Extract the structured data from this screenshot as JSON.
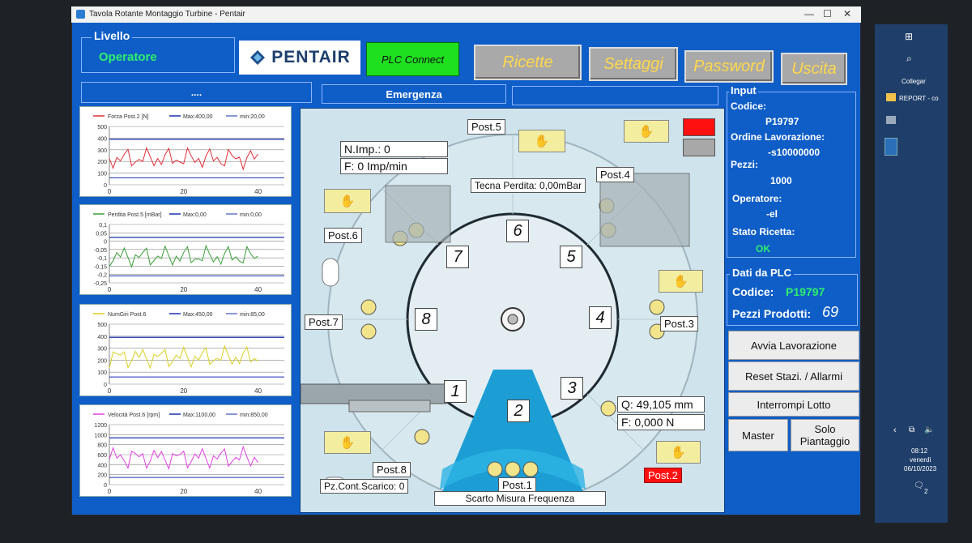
{
  "window": {
    "title": "Tavola Rotante Montaggio Turbine - Pentair"
  },
  "level": {
    "group_label": "Livello",
    "value": "Operatore"
  },
  "logo": {
    "text": "PENTAIR"
  },
  "plc": {
    "label": "PLC Connect",
    "color": "#1ee01e"
  },
  "toolbar": {
    "recipes": "Ricette",
    "settings": "Settaggi",
    "password": "Password",
    "exit": "Uscita"
  },
  "status": {
    "left": "....",
    "emergency": "Emergenza"
  },
  "charts": [
    {
      "legend_name": "Forza Post.2 [N]",
      "legend_max": "Max:400,00",
      "legend_min": "min:20,00",
      "y_ticks": [
        "500",
        "400",
        "300",
        "200",
        "100",
        "0"
      ],
      "x_ticks": [
        "0",
        "20",
        "40"
      ],
      "series_color": "#e0303a"
    },
    {
      "legend_name": "Perdita Post.5 [mBar]",
      "legend_max": "Max:0,00",
      "legend_min": "min:0,00",
      "y_ticks": [
        "0,1",
        "0,05",
        "0",
        "-0,05",
        "-0,1",
        "-0,15",
        "-0,2",
        "-0,25"
      ],
      "x_ticks": [
        "0",
        "20",
        "40"
      ],
      "series_color": "#3aa03a"
    },
    {
      "legend_name": "NumGiri Post.6",
      "legend_max": "Max:450,00",
      "legend_min": "min:85,00",
      "y_ticks": [
        "500",
        "400",
        "300",
        "200",
        "100",
        "0"
      ],
      "x_ticks": [
        "0",
        "20",
        "40"
      ],
      "series_color": "#d8d020"
    },
    {
      "legend_name": "Velocità Post.6 [rpm]",
      "legend_max": "Max:1100,00",
      "legend_min": "min:850,00",
      "y_ticks": [
        "1200",
        "1000",
        "800",
        "600",
        "400",
        "200",
        "0"
      ],
      "x_ticks": [
        "0",
        "20",
        "40"
      ],
      "series_color": "#e040e0"
    }
  ],
  "stations": {
    "post1": "Post.1",
    "post2": "Post.2",
    "post3": "Post.3",
    "post4": "Post.4",
    "post5": "Post.5",
    "post6": "Post.6",
    "post7": "Post.7",
    "post8": "Post.8"
  },
  "slots": [
    "1",
    "2",
    "3",
    "4",
    "5",
    "6",
    "7",
    "8"
  ],
  "readouts": {
    "n_imp": "N.Imp.: 0",
    "freq": "F: 0 Imp/min",
    "leak_test": "Tecna Perdita: 0,00mBar",
    "q": "Q: 49,105 mm",
    "force": "F: 0,000 N",
    "pz_count": "Pz.Cont.Scarico: 0",
    "reject": "Scarto Misura Frequenza"
  },
  "input": {
    "group_label": "Input",
    "code_label": "Codice:",
    "code_value": "P19797",
    "order_label": "Ordine Lavorazione:",
    "order_value": "-s10000000",
    "pieces_label": "Pezzi:",
    "pieces_value": "1000",
    "operator_label": "Operatore:",
    "operator_value": "-el",
    "recipe_state_label": "Stato Ricetta:",
    "recipe_state_value": "OK"
  },
  "plc_data": {
    "group_label": "Dati da PLC",
    "code_label": "Codice:",
    "code_value": "P19797",
    "produced_label": "Pezzi Prodotti:",
    "produced_value": "69"
  },
  "actions": {
    "start": "Avvia Lavorazione",
    "reset": "Reset Stazi. / Allarmi",
    "stop": "Interrompi Lotto",
    "master": "Master",
    "only_planting": "Solo Piantaggio"
  },
  "taskbar": {
    "collegar": "Collegar",
    "report": "REPORT - co",
    "time": "08:12",
    "day": "venerdì",
    "date": "06/10/2023",
    "notif_count": "2"
  },
  "colors": {
    "alarm_red": "#ff1010",
    "ok_green": "#2ef06a",
    "panel_blue": "#0f5ec8"
  }
}
